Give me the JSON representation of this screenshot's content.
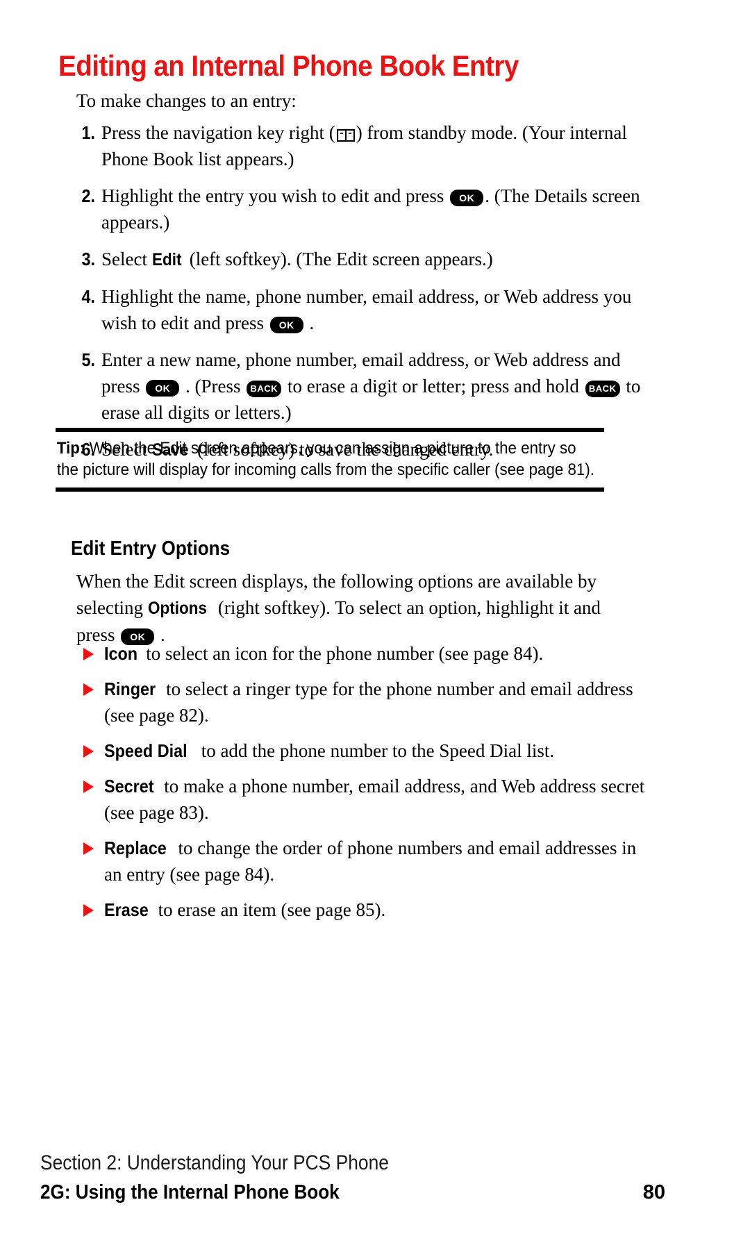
{
  "title": "Editing an Internal Phone Book Entry",
  "intro": "To make changes to an entry:",
  "steps": [
    {
      "num": "1.",
      "pre": "Press the navigation key right (",
      "icon": "phone-book-icon",
      "post": ") from standby mode. (Your internal Phone Book list appears.)"
    },
    {
      "num": "2.",
      "pre": "Highlight the entry you wish to edit and press",
      "key1": "OK",
      "post": ". (The Details screen appears.)"
    },
    {
      "num": "3.",
      "pre": "Select",
      "bold": "Edit",
      "post": "(left softkey). (The Edit screen appears.)"
    },
    {
      "num": "4.",
      "pre": "Highlight the name, phone number, email address, or Web address you wish to edit and press",
      "key1": "OK",
      "post": "."
    },
    {
      "num": "5.",
      "pre": "Enter a new name, phone number, email address, or Web address and press",
      "key1": "OK",
      "mid1": ". (Press",
      "key2": "BACK",
      "mid2": "to erase a digit or letter; press and hold",
      "key3": "BACK",
      "post": "to erase all digits or letters.)"
    },
    {
      "num": "6.",
      "pre": "Select",
      "bold": "Save",
      "post": "(left softkey) to save the changed entry."
    }
  ],
  "tip": {
    "label": "Tip:",
    "text": "When the Edit screen appears, you can assign a picture to the entry so the picture will display for incoming calls from the specific caller (see page 81)."
  },
  "subsection": {
    "heading": "Edit Entry Options",
    "intro_pre": "When the Edit screen displays, the following options are available by selecting",
    "intro_bold": "Options",
    "intro_mid": "(right softkey). To select an option, highlight it and press",
    "intro_key": "OK",
    "intro_post": "."
  },
  "options": [
    {
      "name": "Icon",
      "desc": "to select an icon for the phone number (see page 84)."
    },
    {
      "name": "Ringer",
      "desc": "to select a ringer type for the phone number and email address (see page 82)."
    },
    {
      "name": "Speed Dial",
      "desc": "to add the phone number to the Speed Dial list."
    },
    {
      "name": "Secret",
      "desc": "to make a phone number, email address, and Web address secret (see page 83)."
    },
    {
      "name": "Replace",
      "desc": "to change the order of phone numbers and email addresses in an entry (see page 84)."
    },
    {
      "name": "Erase",
      "desc": "to erase an item (see page 85)."
    }
  ],
  "footer": {
    "section_line": "Section 2: Understanding Your PCS Phone",
    "chapter_line": "2G: Using the Internal Phone Book",
    "page_number": "80"
  },
  "colors": {
    "title_red": "#ee1111",
    "bullet_red": "#ee1111",
    "text_black": "#000000",
    "page_background": "#ffffff"
  }
}
